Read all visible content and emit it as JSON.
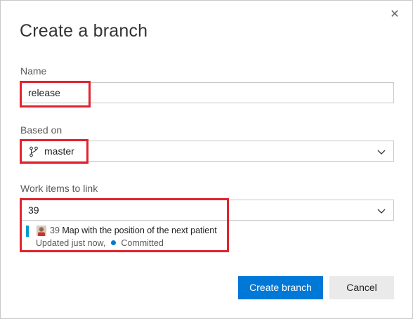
{
  "dialog": {
    "title": "Create a branch",
    "close_glyph": "✕"
  },
  "name_field": {
    "label": "Name",
    "value": "release"
  },
  "based_on_field": {
    "label": "Based on",
    "value": "master",
    "icon": "git-branch-icon"
  },
  "work_items_field": {
    "label": "Work items to link",
    "value": "39",
    "item": {
      "id": "39",
      "title": "Map with the position of the next patient",
      "updated": "Updated just now,",
      "state": "Committed",
      "type_color": "#009ccc",
      "state_color": "#007acc"
    }
  },
  "buttons": {
    "create": "Create branch",
    "cancel": "Cancel"
  },
  "colors": {
    "primary": "#0078d7",
    "highlight": "#e0232e"
  }
}
